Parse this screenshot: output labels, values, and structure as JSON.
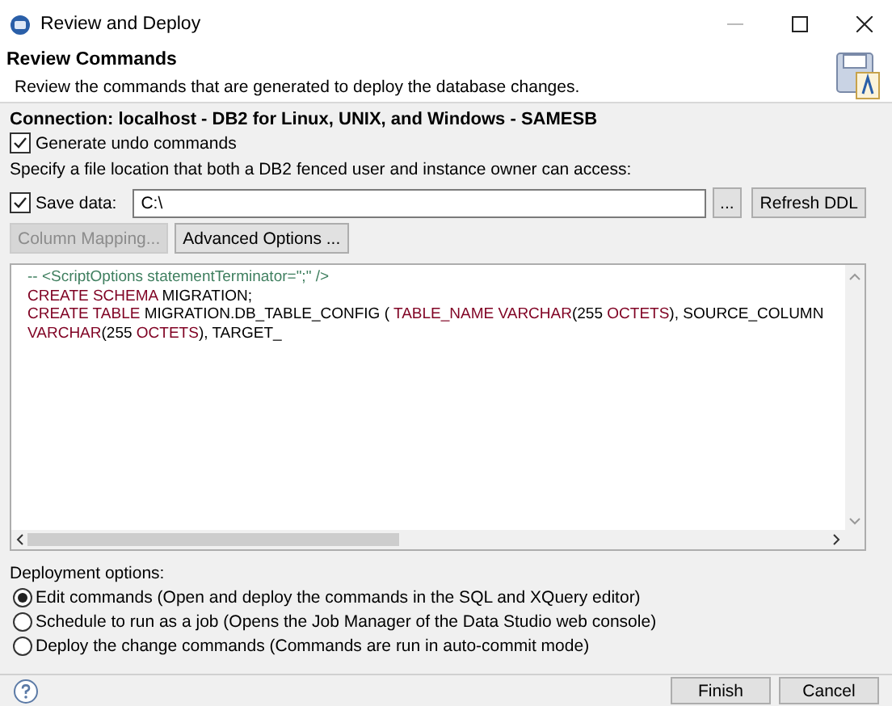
{
  "window": {
    "title": "Review and Deploy"
  },
  "header": {
    "title": "Review Commands",
    "description": "Review the commands that are generated to deploy the database changes."
  },
  "connection": "Connection: localhost - DB2 for Linux, UNIX, and Windows - SAMESB",
  "undo": {
    "label": "Generate undo commands",
    "checked": true
  },
  "location_hint": "Specify a file location that both a DB2 fenced user and instance owner can access:",
  "save_data": {
    "label": "Save data:",
    "checked": true,
    "value": "C:\\",
    "browse": "...",
    "refresh": "Refresh DDL"
  },
  "actions": [
    {
      "label": "Column Mapping...",
      "disabled": true
    },
    {
      "label": "Advanced Options ...",
      "disabled": false
    }
  ],
  "code": [
    [
      {
        "kind": "comment",
        "text": "-- <ScriptOptions statementTerminator=\";\" />"
      }
    ],
    [
      {
        "kind": "keyword",
        "text": "CREATE SCHEMA"
      },
      {
        "kind": "plain",
        "text": " MIGRATION;"
      }
    ],
    [
      {
        "kind": "keyword",
        "text": "CREATE TABLE"
      },
      {
        "kind": "plain",
        "text": " MIGRATION.DB_TABLE_CONFIG ( "
      },
      {
        "kind": "keyword",
        "text": "TABLE_NAME VARCHAR"
      },
      {
        "kind": "plain",
        "text": "(255 "
      },
      {
        "kind": "keyword",
        "text": "OCTETS"
      },
      {
        "kind": "plain",
        "text": "), SOURCE_COLUMN "
      },
      {
        "kind": "keyword",
        "text": "VARCHAR"
      },
      {
        "kind": "plain",
        "text": "(255 "
      },
      {
        "kind": "keyword",
        "text": "OCTETS"
      },
      {
        "kind": "plain",
        "text": "), TARGET_"
      }
    ]
  ],
  "deployment": {
    "label": "Deployment options:",
    "options": [
      {
        "label": "Edit commands (Open and deploy the commands in the SQL and XQuery editor)",
        "selected": true
      },
      {
        "label": "Schedule to run as a job (Opens the Job Manager of the Data Studio web console)",
        "selected": false
      },
      {
        "label": "Deploy the change commands (Commands are run in auto-commit mode)",
        "selected": false
      }
    ]
  },
  "buttons": [
    "Finish",
    "Cancel"
  ]
}
